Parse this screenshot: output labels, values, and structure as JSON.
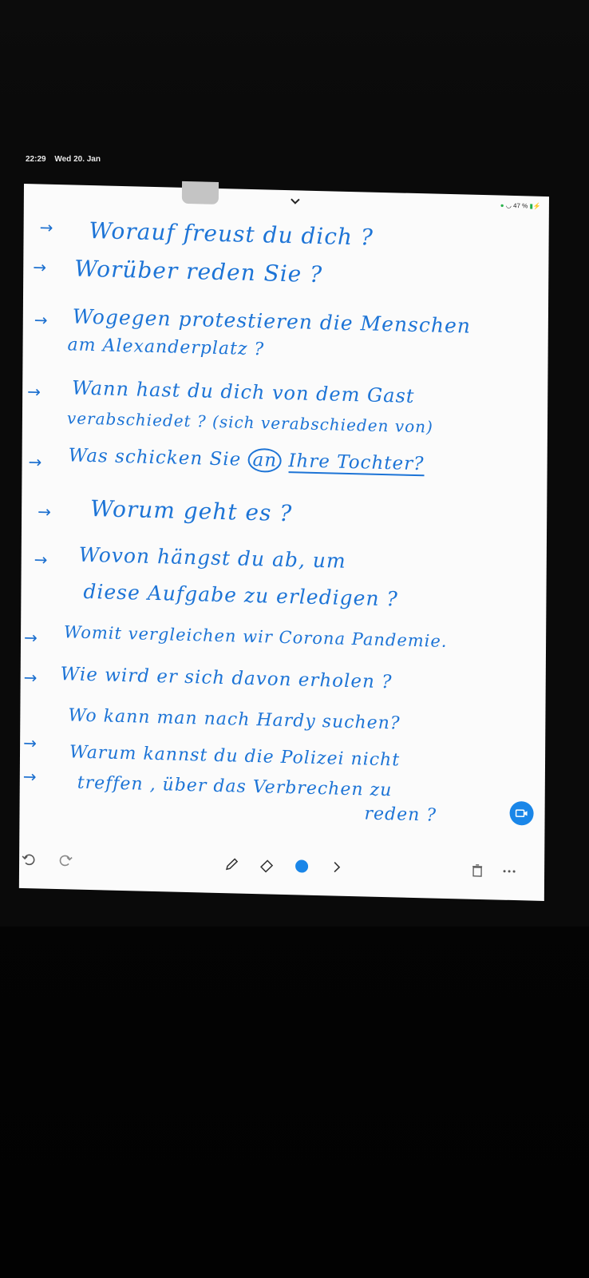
{
  "status_bar": {
    "time": "22:29",
    "date": "Wed 20. Jan",
    "battery": "47 %"
  },
  "notes": {
    "lines": [
      {
        "text": "Worauf freust du dich ?"
      },
      {
        "text": "Worüber reden Sie ?"
      },
      {
        "text": "Wogegen protestieren die Menschen"
      },
      {
        "text": "am Alexanderplatz ?"
      },
      {
        "text": "Wann hast du dich von dem Gast"
      },
      {
        "text": "verabschiedet ? (sich verabschieden von)"
      },
      {
        "text_a": "Was schicken Sie",
        "text_b": "an",
        "text_c": "Ihre Tochter?"
      },
      {
        "text": "Worum geht es ?"
      },
      {
        "text": "Wovon hängst du ab, um"
      },
      {
        "text": "diese Aufgabe zu erledigen ?"
      },
      {
        "text": "Womit vergleichen wir Corona Pandemie."
      },
      {
        "text": "Wie wird er sich davon erholen ?"
      },
      {
        "text": "Wo kann man nach Hardy suchen?"
      },
      {
        "text": "Warum kannst du die Polizei nicht"
      },
      {
        "text": "treffen , über das Verbrechen zu"
      },
      {
        "text": "reden ?"
      }
    ],
    "arrow_glyph": "→"
  },
  "toolbar": {
    "icons": [
      "undo-icon",
      "redo-icon",
      "pen-icon",
      "eraser-icon",
      "color-dot",
      "chevron-right-icon",
      "trash-icon",
      "more-icon"
    ],
    "accent_color": "#1a86e8",
    "ink_color": "#1d74d6"
  }
}
